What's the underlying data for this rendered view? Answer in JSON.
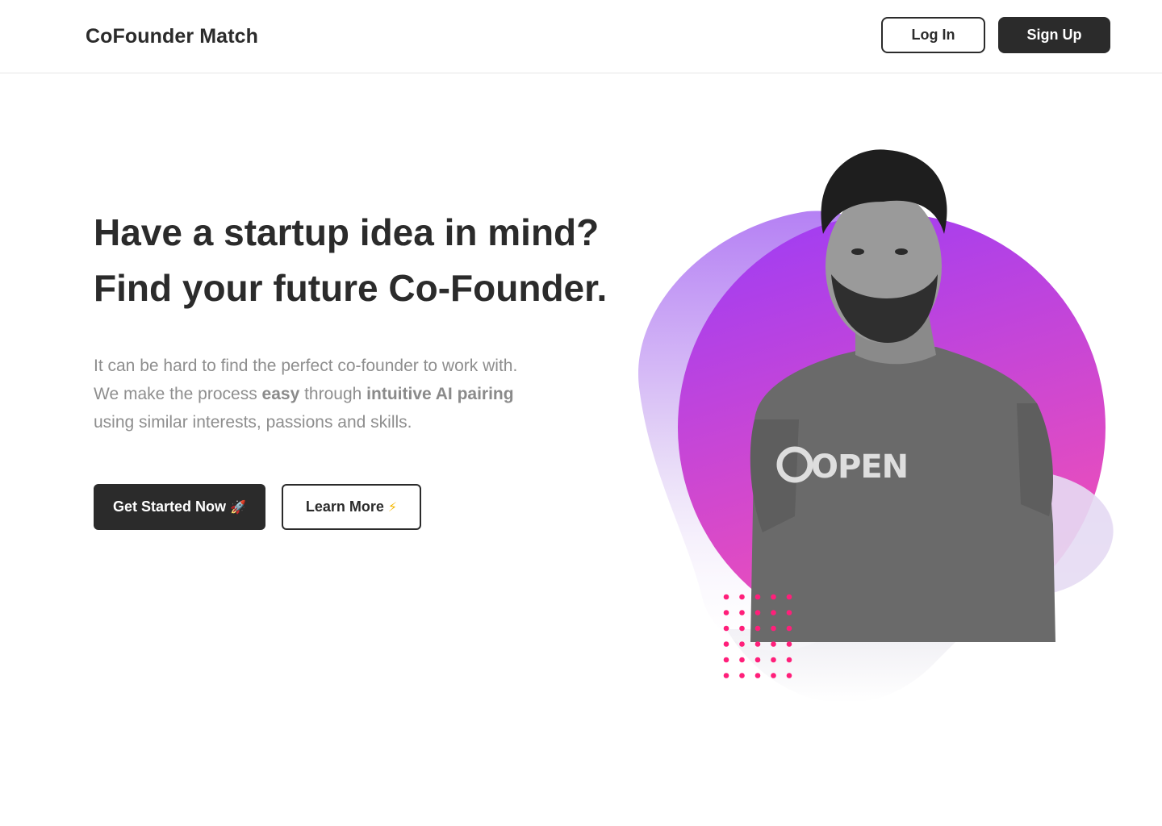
{
  "header": {
    "brand": "CoFounder Match",
    "login_label": "Log In",
    "signup_label": "Sign Up"
  },
  "hero": {
    "headline_line1": "Have a startup idea in mind?",
    "headline_line2": "Find your future Co-Founder.",
    "description": {
      "line1": "It can be hard to find the perfect co-founder to work with.",
      "line2_pre": "We make the process ",
      "line2_easy": "easy",
      "line2_mid": " through ",
      "line2_ai": "intuitive AI pairing",
      "line3": "using similar interests, passions and skills."
    },
    "cta_primary_label": "Get Started Now",
    "cta_primary_icon": "🚀",
    "cta_secondary_label": "Learn More",
    "cta_secondary_icon": "⚡",
    "shirt_text": "OPEN"
  },
  "colors": {
    "dark": "#2b2b2b",
    "muted_text": "#8e8e8e",
    "circle_top": "#9b3cf7",
    "circle_bottom": "#f04fb7",
    "dots": "#ff1f7a",
    "blob_light": "#e9def5"
  }
}
